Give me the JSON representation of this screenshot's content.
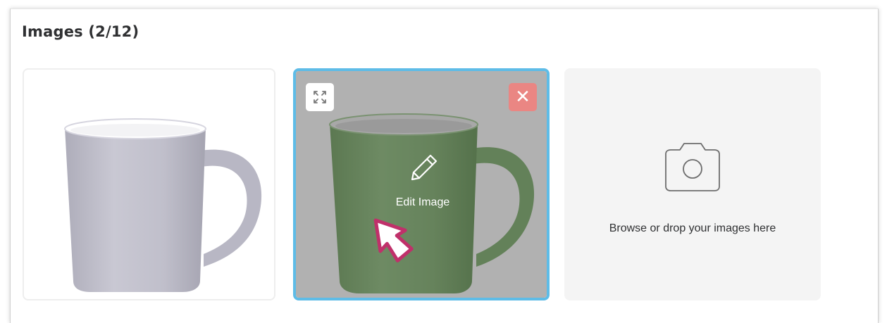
{
  "section": {
    "title": "Images (2/12)"
  },
  "images": [
    {
      "color_name": "lavender-grey",
      "body_color": "#c0bfcb"
    },
    {
      "color_name": "green",
      "body_color": "#8ab77a",
      "selected": true
    }
  ],
  "controls": {
    "expand_icon": "expand-icon",
    "close_label": "✕",
    "edit_label": "Edit Image"
  },
  "dropzone": {
    "icon": "camera-icon",
    "text": "Browse or drop your images here"
  },
  "colors": {
    "selected_border": "#5ebce7",
    "close_button": "#ea8683",
    "cursor_accent": "#c0306a"
  }
}
